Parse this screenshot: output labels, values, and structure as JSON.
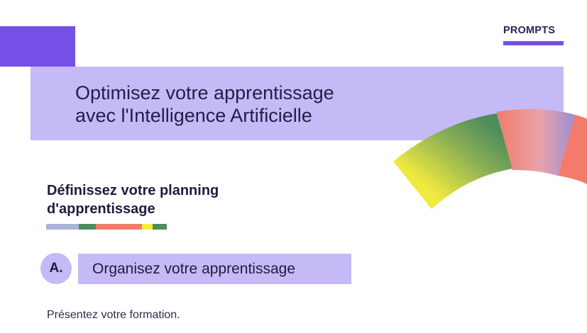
{
  "header": {
    "tag_label": "PROMPTS",
    "title_line1": "Optimisez votre apprentissage",
    "title_line2": "avec l'Intelligence Artificielle"
  },
  "section": {
    "title_line1": "Définissez votre planning",
    "title_line2": "d'apprentissage"
  },
  "step": {
    "badge": "A.",
    "label": "Organisez votre apprentissage"
  },
  "body": {
    "text": "Présentez votre formation."
  },
  "colors": {
    "accent_purple": "#7450e6",
    "light_purple": "#c5baf5",
    "green": "#4e8d5b",
    "coral": "#f27b6b",
    "yellow": "#f5ee3e",
    "lavender": "#aab3d9"
  },
  "color_bar": [
    {
      "color": "#aab3d9",
      "weight": 46
    },
    {
      "color": "#4e8d5b",
      "weight": 24
    },
    {
      "color": "#f27b6b",
      "weight": 65
    },
    {
      "color": "#f5ee3e",
      "weight": 15
    },
    {
      "color": "#4e8d5b",
      "weight": 20
    }
  ]
}
